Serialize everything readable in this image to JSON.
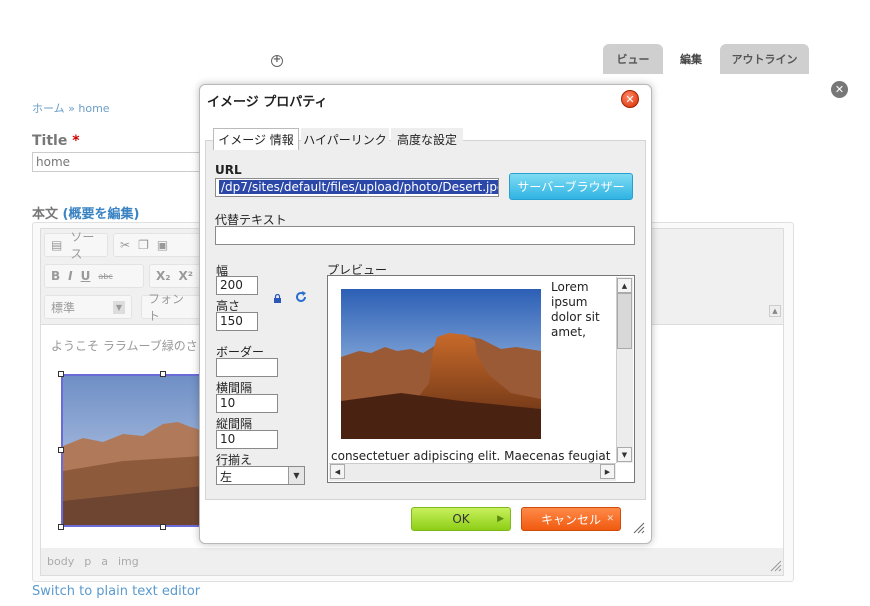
{
  "page": {
    "tabs": [
      "ビュー",
      "編集",
      "アウトライン"
    ],
    "breadcrumb": "ホーム » home",
    "title_label": "Title",
    "title_required": "*",
    "title_value": "home",
    "body_label": "本文",
    "body_link": "(概要を編集)",
    "toolbar": {
      "source": "ソース",
      "format": "標準",
      "font": "フォント",
      "bold": "B",
      "italic": "I",
      "underline": "U",
      "strike": "abc",
      "subscript": "X₂",
      "superscript": "X²"
    },
    "content_text": "ようこそ ララムーブ緑のさいと",
    "statusbar": [
      "body",
      "p",
      "a",
      "img"
    ],
    "plain_text_link": "Switch to plain text editor"
  },
  "dialog": {
    "title": "イメージ プロパティ",
    "tabs": [
      "イメージ 情報",
      "ハイパーリンク",
      "高度な設定"
    ],
    "url_label": "URL",
    "url_value": "/dp7/sites/default/files/upload/photo/Desert.jpg",
    "server_button": "サーバーブラウザー",
    "alt_label": "代替テキスト",
    "alt_value": "",
    "width_label": "幅",
    "width_value": "200",
    "height_label": "高さ",
    "height_value": "150",
    "border_label": "ボーダー",
    "border_value": "",
    "hspace_label": "横間隔",
    "hspace_value": "10",
    "vspace_label": "縦間隔",
    "vspace_value": "10",
    "align_label": "行揃え",
    "align_value": "左",
    "preview_label": "プレビュー",
    "preview_text_words": [
      "Lorem",
      "ipsum",
      "dolor sit",
      "amet,"
    ],
    "preview_text_below": "consectetuer adipiscing elit. Maecenas feugiat",
    "ok": "OK",
    "cancel": "キャンセル"
  },
  "colors": {
    "accent_blue": "#2fb3e3",
    "ok_green": "#8dcf17",
    "cancel_orange": "#f05a10",
    "link": "#5a9ad0"
  }
}
